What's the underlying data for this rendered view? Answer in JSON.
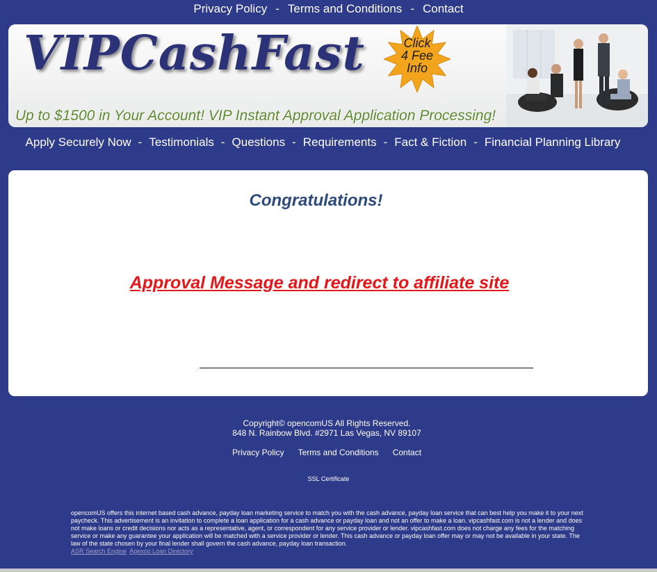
{
  "top_nav": [
    "Privacy Policy",
    "Terms and Conditions",
    "Contact"
  ],
  "banner": {
    "logo": "VIPCashFast",
    "starburst": [
      "Click",
      "4 Fee",
      "Info"
    ],
    "tagline": "Up to $1500 in Your Account! VIP Instant Approval Application Processing!"
  },
  "main_nav": [
    "Apply Securely Now",
    "Testimonials",
    "Questions",
    "Requirements",
    "Fact & Fiction",
    "Financial Planning Library"
  ],
  "content": {
    "heading": "Congratulations!",
    "message": "Approval Message and redirect to affiliate site"
  },
  "footer": {
    "copyright": "Copyright© opencomUS All Rights Reserved.",
    "address": "848 N. Rainbow Blvd. #2971 Las Vegas, NV 89107",
    "links": [
      "Privacy Policy",
      "Terms and Conditions",
      "Contact"
    ],
    "ssl": "SSL Certificate",
    "disclaimer": "opencomUS offers this internet based cash advance, payday loan marketing service to match you with the cash advance, payday loan service that can best help you make it to your next paycheck. This advertisement is an invitation to complete a loan application for a cash advance or payday loan and not an offer to make a loan. vipcashfast.com is not a lender and does not make loans or credit decisions nor acts as a representative, agent, or correspondent for any service provider or lender. vipcashfast.com does not charge any fees for the matching service or make any guarantee your application will be matched with a service provider or lender. This cash advance or payday loan offer may or may not be available in your state. The law of the state chosen by your final lender shall govern the cash advance, payday loan transaction.",
    "extra_links": [
      "ASR Search Engine",
      "Agexoo Loan Directory"
    ]
  },
  "colors": {
    "background": "#2e3a8a",
    "logo": "#2b3278",
    "tagline": "#5e8a2f",
    "heading": "#2d4a7e",
    "message": "#e3171a",
    "starburst": "#f2a51c"
  }
}
